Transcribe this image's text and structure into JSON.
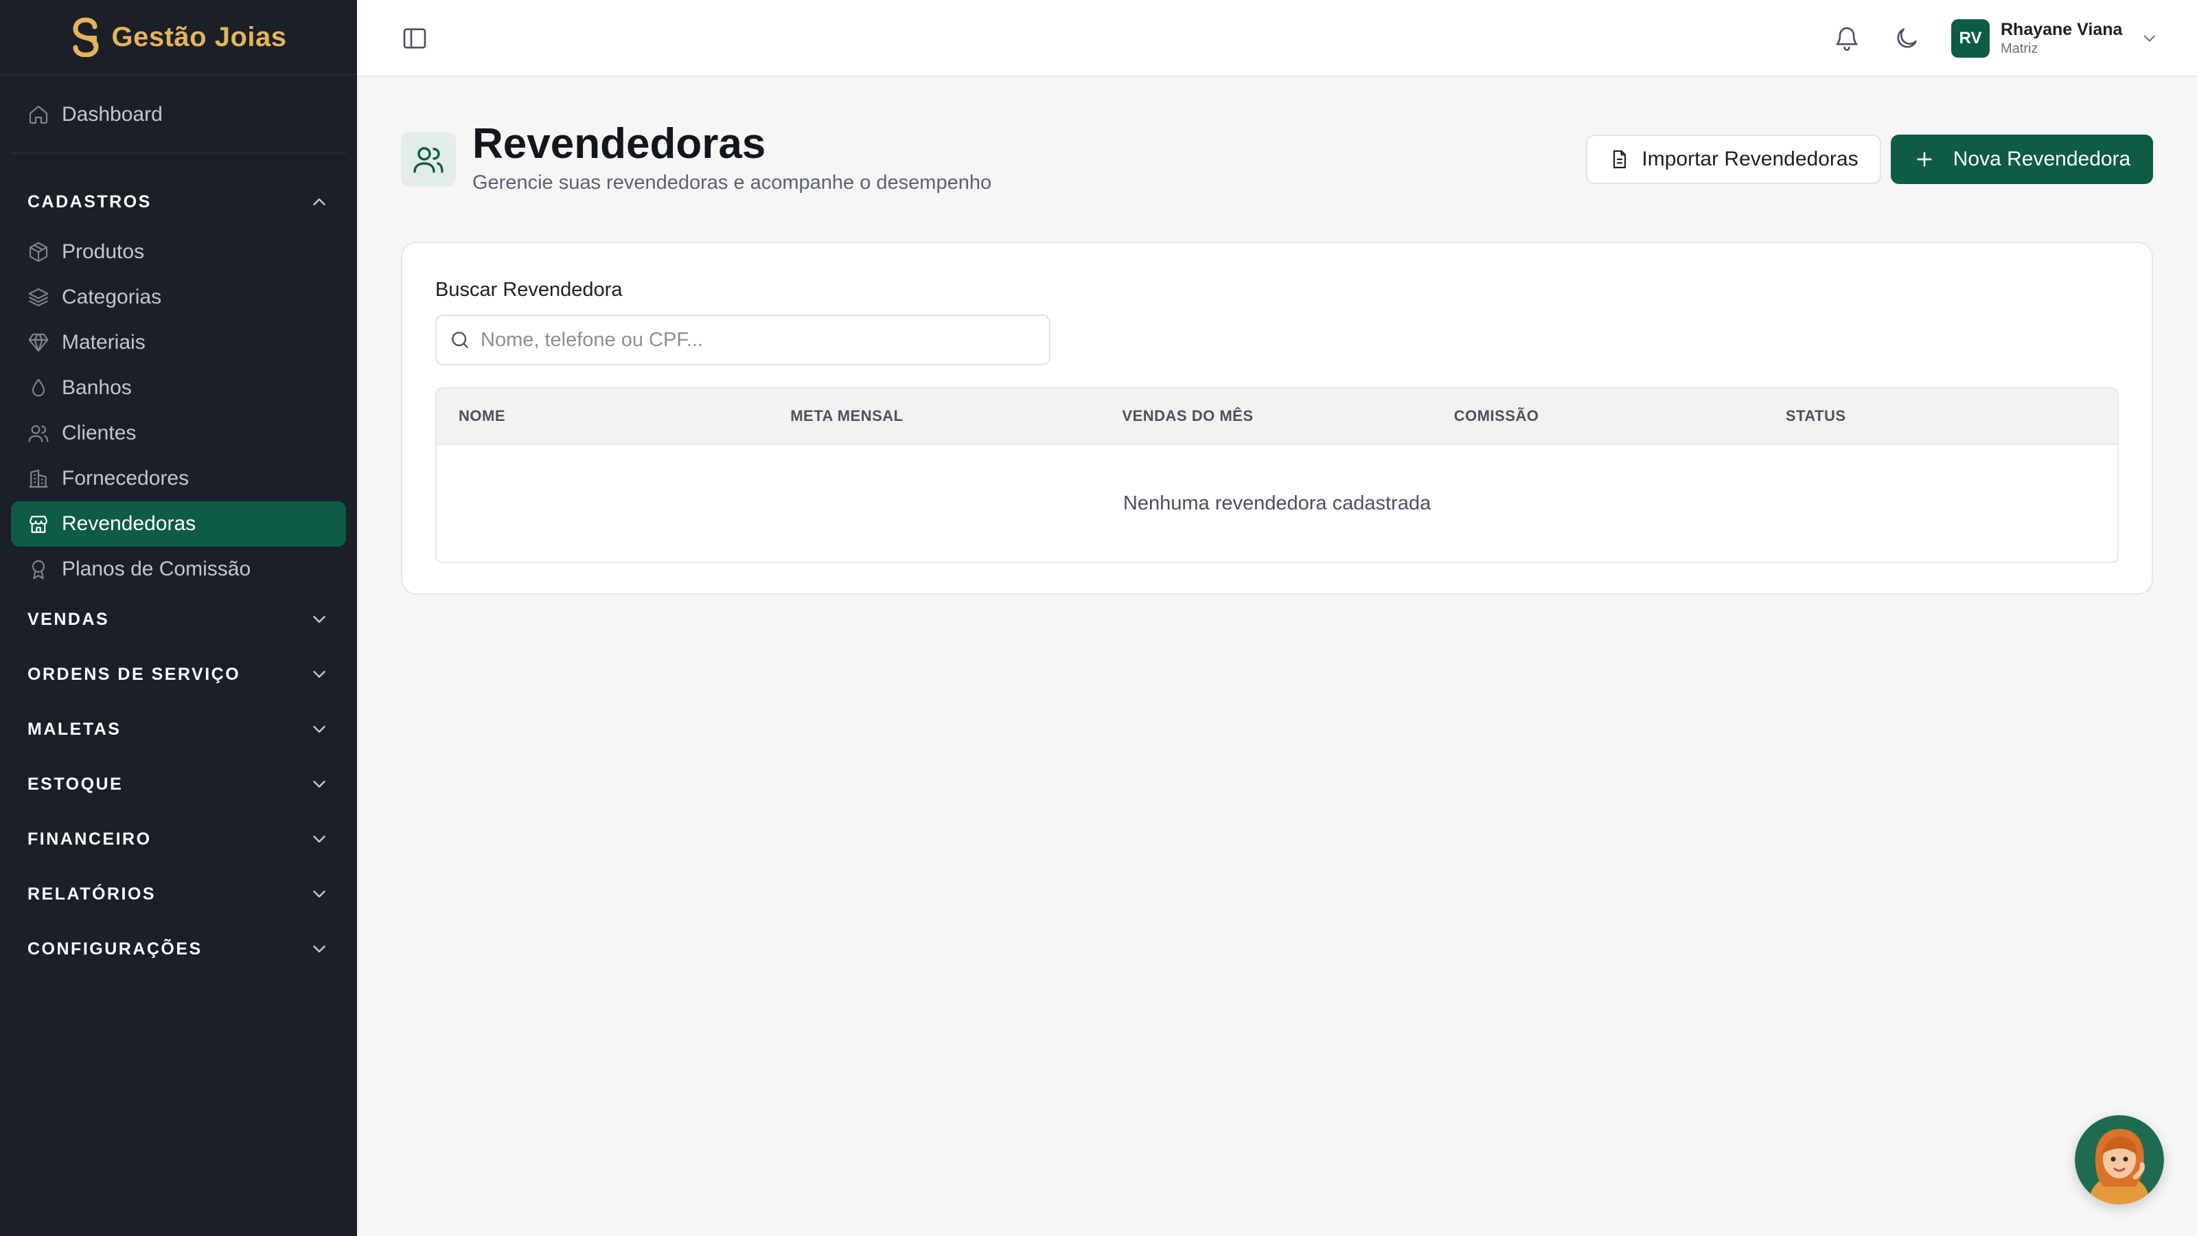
{
  "brand": {
    "name": "Gestão Joias",
    "color": "#e3b45c"
  },
  "colors": {
    "primary": "#0e5c45",
    "sidebar_bg": "#1b1f27"
  },
  "sidebar": {
    "dashboard": {
      "label": "Dashboard",
      "icon": "home-icon"
    },
    "cadastros": {
      "title": "CADASTROS",
      "expanded": true,
      "items": [
        {
          "label": "Produtos",
          "icon": "box-icon"
        },
        {
          "label": "Categorias",
          "icon": "layers-icon"
        },
        {
          "label": "Materiais",
          "icon": "gem-icon"
        },
        {
          "label": "Banhos",
          "icon": "droplet-icon"
        },
        {
          "label": "Clientes",
          "icon": "users-icon"
        },
        {
          "label": "Fornecedores",
          "icon": "building-icon"
        },
        {
          "label": "Revendedoras",
          "icon": "store-icon",
          "active": true
        },
        {
          "label": "Planos de Comissão",
          "icon": "award-icon"
        }
      ]
    },
    "sections": [
      {
        "title": "VENDAS"
      },
      {
        "title": "ORDENS DE SERVIÇO"
      },
      {
        "title": "MALETAS"
      },
      {
        "title": "ESTOQUE"
      },
      {
        "title": "FINANCEIRO"
      },
      {
        "title": "RELATÓRIOS"
      },
      {
        "title": "CONFIGURAÇÕES"
      }
    ]
  },
  "topbar": {
    "user": {
      "initials": "RV",
      "name": "Rhayane Viana",
      "role": "Matriz"
    }
  },
  "page": {
    "title": "Revendedoras",
    "subtitle": "Gerencie suas revendedoras e acompanhe o desempenho",
    "import_button": "Importar Revendedoras",
    "new_button": "Nova Revendedora"
  },
  "search": {
    "label": "Buscar Revendedora",
    "placeholder": "Nome, telefone ou CPF...",
    "value": ""
  },
  "table": {
    "columns": [
      "NOME",
      "META MENSAL",
      "VENDAS DO MÊS",
      "COMISSÃO",
      "STATUS"
    ],
    "rows": [],
    "empty_message": "Nenhuma revendedora cadastrada"
  }
}
